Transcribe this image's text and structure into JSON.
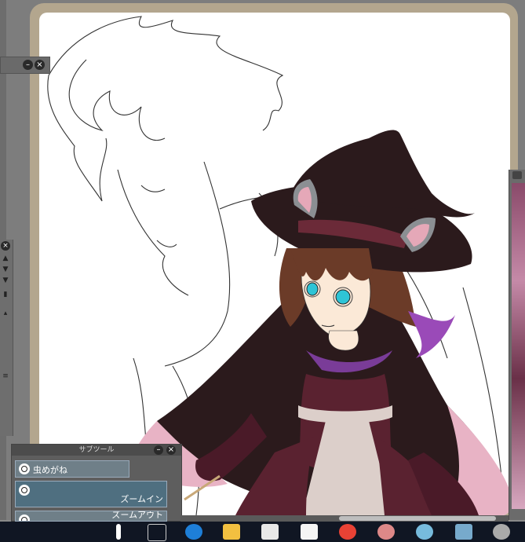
{
  "subtool_panel": {
    "title": "サブツール",
    "items": [
      {
        "label": "虫めがね"
      },
      {
        "label": "ズームイン"
      },
      {
        "label": "ズームアウト"
      }
    ]
  },
  "taskbar": {
    "icons": [
      "task-view-icon",
      "edge-icon",
      "file-explorer-icon",
      "store-icon",
      "mail-icon",
      "chrome-icon",
      "app-icon",
      "clip-studio-icon",
      "line-icon",
      "file-icon",
      "settings-icon"
    ]
  },
  "colors": {
    "frame": "#b3a68e",
    "hat": "#2b1a1c",
    "hat_band": "#6b2a38",
    "hair": "#6b3b28",
    "dress": "#5a2230",
    "cape_inner": "#e8b3c5",
    "ribbon": "#9a4ab8",
    "eyes": "#2ec4d6"
  }
}
